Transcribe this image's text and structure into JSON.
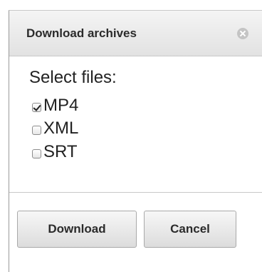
{
  "dialog": {
    "title": "Download archives",
    "select_label": "Select files:",
    "options": [
      {
        "label": "MP4",
        "checked": true
      },
      {
        "label": "XML",
        "checked": false
      },
      {
        "label": "SRT",
        "checked": false
      }
    ],
    "download_label": "Download",
    "cancel_label": "Cancel"
  },
  "icons": {
    "close": "close-icon"
  }
}
